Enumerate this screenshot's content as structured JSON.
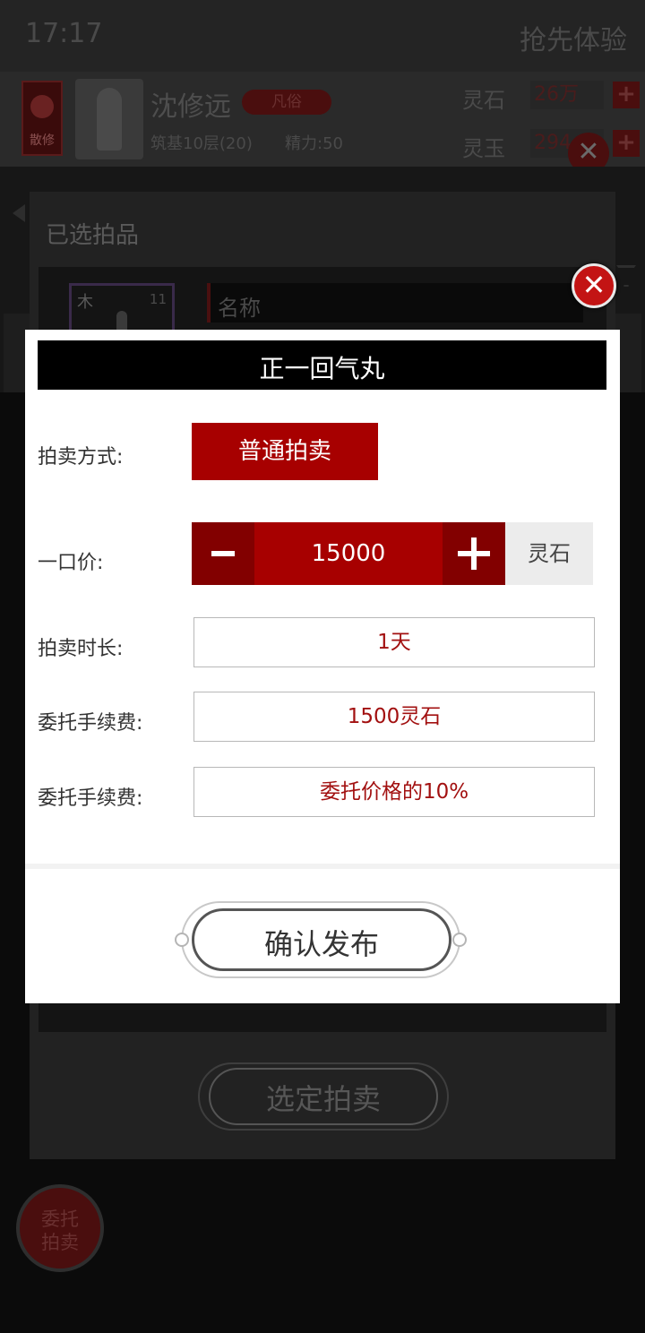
{
  "status_bar": {
    "time": "17:17",
    "right_text": "抢先体验"
  },
  "player": {
    "sect_label": "散修",
    "name": "沈修远",
    "rank": "凡俗",
    "level": "筑基10层(20)",
    "energy": "精力:50"
  },
  "resources": [
    {
      "label": "灵石",
      "value": "26万",
      "plus": "+"
    },
    {
      "label": "灵玉",
      "value": "294",
      "plus": "+"
    }
  ],
  "page_close_glyph": "✕",
  "selected_panel": {
    "title": "已选拍品",
    "close_glyph": "✕",
    "item": {
      "element": "木",
      "count": "11"
    },
    "name_header": "名称",
    "select_button": "选定拍卖"
  },
  "consign_button": "委托拍卖",
  "modal": {
    "title": "正一回气丸",
    "method": {
      "label": "拍卖方式:",
      "value": "普通拍卖"
    },
    "buyout": {
      "label": "一口价:",
      "value": "15000",
      "currency": "灵石"
    },
    "duration": {
      "label": "拍卖时长:",
      "value": "1天"
    },
    "fee": {
      "label": "委托手续费:",
      "value": "1500灵石"
    },
    "fee_rate": {
      "label": "委托手续费:",
      "value": "委托价格的10%"
    },
    "confirm_button": "确认发布"
  },
  "colors": {
    "accent": "#a70000",
    "accent_dark": "#820000",
    "close_red": "#c31414",
    "value_text": "#a21010"
  }
}
